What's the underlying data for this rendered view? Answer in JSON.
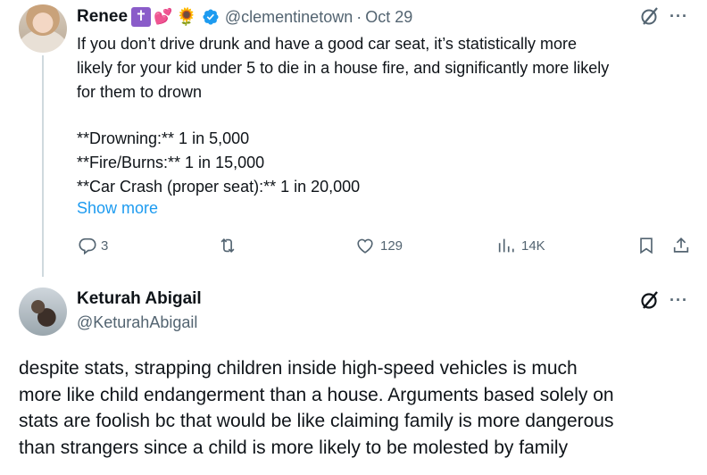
{
  "tweet": {
    "author_name": "Renee",
    "author_emojis": [
      "✝",
      "💕",
      "🌻"
    ],
    "handle": "@clementinetown",
    "separator": "·",
    "date": "Oct 29",
    "body_lines": [
      "If you don’t drive drunk and have a good car seat, it’s statistically more",
      "likely for your kid under 5 to die in a house fire, and significantly more likely",
      "for them to drown"
    ],
    "stats": [
      "**Drowning:** 1 in 5,000",
      "**Fire/Burns:** 1 in 15,000",
      "**Car Crash (proper seat):** 1 in 20,000"
    ],
    "show_more": "Show more",
    "replies": "3",
    "likes": "129",
    "views": "14K",
    "icons": [
      "reply-icon",
      "retweet-icon",
      "like-icon",
      "views-icon",
      "bookmark-icon",
      "share-icon",
      "grok-icon",
      "more-icon",
      "verified-icon"
    ],
    "colors": {
      "link": "#1d9bf0",
      "muted": "#536471",
      "verified": "#1d9bf0"
    }
  },
  "reply": {
    "author_name": "Keturah Abigail",
    "handle": "@KeturahAbigail",
    "body_lines": [
      "despite stats, strapping children inside high-speed vehicles is much",
      "more like child endangerment than a house. Arguments based solely on",
      "stats are foolish bc that would be like claiming family is more dangerous",
      "than strangers since a child is more likely to be molested by family"
    ]
  }
}
